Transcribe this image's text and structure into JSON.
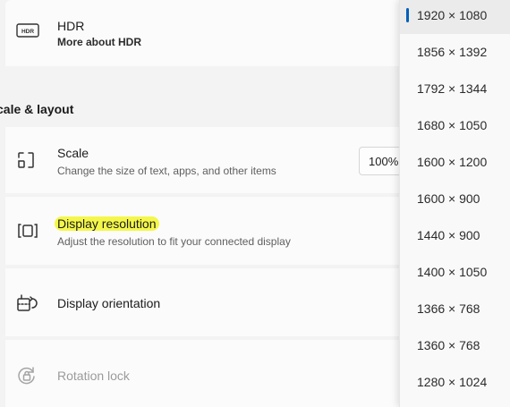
{
  "hdr": {
    "icon": "hdr-icon",
    "badge": "HDR",
    "title": "HDR",
    "link": "More about HDR"
  },
  "scale_layout": {
    "header": "cale & layout"
  },
  "scale": {
    "icon": "scale-icon",
    "title": "Scale",
    "subtitle": "Change the size of text, apps, and other items",
    "value": "100%"
  },
  "resolution": {
    "icon": "display-resolution-icon",
    "title": "Display resolution",
    "subtitle": "Adjust the resolution to fit your connected display",
    "highlight_color": "#f4f74a"
  },
  "orientation": {
    "icon": "display-orientation-icon",
    "title": "Display orientation"
  },
  "rotation": {
    "icon": "rotation-lock-icon",
    "title": "Rotation lock",
    "disabled": true
  },
  "dropdown": {
    "selected_index": 0,
    "accent": "#005fb8",
    "options": [
      "1920 × 1080",
      "1856 × 1392",
      "1792 × 1344",
      "1680 × 1050",
      "1600 × 1200",
      "1600 × 900",
      "1440 × 900",
      "1400 × 1050",
      "1366 × 768",
      "1360 × 768",
      "1280 × 1024"
    ]
  }
}
